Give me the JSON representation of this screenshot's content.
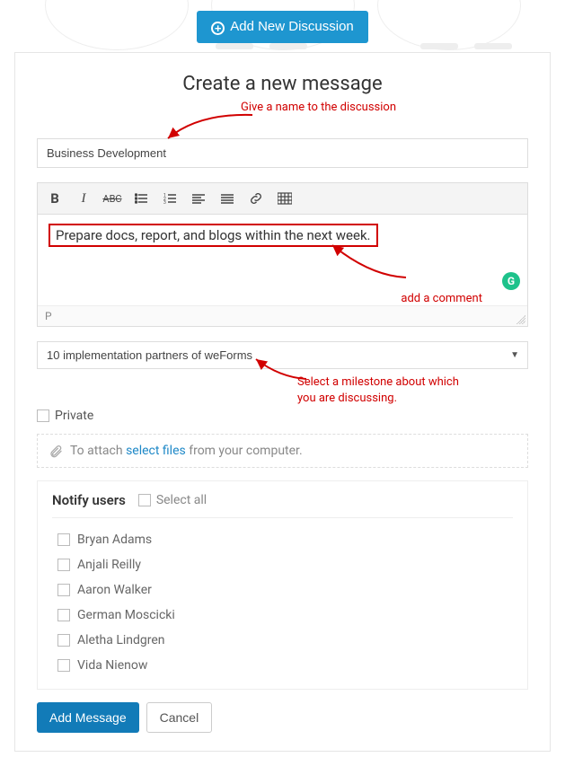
{
  "header": {
    "add_discussion_label": "Add New Discussion"
  },
  "form": {
    "heading": "Create a new message",
    "title_value": "Business Development",
    "editor_content": "Prepare docs, report, and blogs within the next week.",
    "status_path": "P",
    "milestone_selected": "10 implementation partners of weForms",
    "private_label": "Private",
    "attach_prefix": "To attach",
    "attach_link": "select files",
    "attach_suffix": "from your computer.",
    "notify_title": "Notify users",
    "select_all_label": "Select all",
    "users": [
      "Bryan Adams",
      "Anjali Reilly",
      "Aaron Walker",
      "German Moscicki",
      "Aletha Lindgren",
      "Vida Nienow"
    ],
    "add_message_label": "Add Message",
    "cancel_label": "Cancel"
  },
  "annotations": {
    "title_hint": "Give a name to the discussion",
    "comment_hint": "add a comment",
    "milestone_hint_l1": "Select a milestone about which",
    "milestone_hint_l2": "you are discussing."
  },
  "icons": {
    "plus": "+",
    "grammarly": "G"
  }
}
